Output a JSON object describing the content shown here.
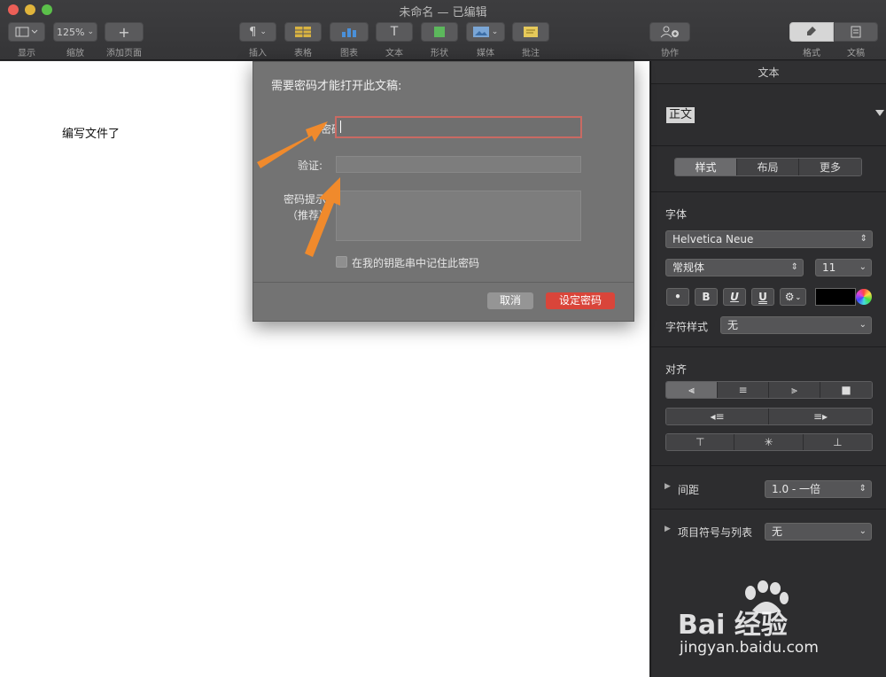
{
  "window": {
    "title": "未命名 — 已编辑"
  },
  "toolbar": {
    "display_label": "显示",
    "zoom_value": "125%",
    "zoom_label": "缩放",
    "add_page_label": "添加页面",
    "insert_label": "插入",
    "table_label": "表格",
    "chart_label": "图表",
    "text_label": "文本",
    "shape_label": "形状",
    "media_label": "媒体",
    "comment_label": "批注",
    "collaborate_label": "协作",
    "format_label": "格式",
    "document_label": "文稿"
  },
  "document": {
    "body_text": "编写文件了"
  },
  "dialog": {
    "title": "需要密码才能打开此文稿:",
    "password_label": "密码",
    "password_value": "",
    "verify_label": "验证:",
    "verify_value": "",
    "hint_label_1": "密码提示",
    "hint_label_2": "（推荐）",
    "hint_value": "",
    "keychain_label": "在我的钥匙串中记住此密码",
    "keychain_checked": false,
    "cancel_label": "取消",
    "set_password_label": "设定密码"
  },
  "sidebar": {
    "header": "文本",
    "paragraph_style": "正文",
    "tabs": [
      {
        "label": "样式",
        "active": true
      },
      {
        "label": "布局",
        "active": false
      },
      {
        "label": "更多",
        "active": false
      }
    ],
    "font_section": "字体",
    "font_family": "Helvetica Neue",
    "font_style": "常规体",
    "font_size": "11",
    "bullet_btn": "•",
    "bold_btn": "B",
    "italic_btn": "I",
    "underline_btn": "U",
    "strike_btn": "U",
    "text_color": "#000000",
    "char_style_label": "字符样式",
    "char_style_value": "无",
    "align_section": "对齐",
    "spacing_label": "间距",
    "spacing_value": "1.0 - 一倍",
    "bullets_label": "项目符号与列表",
    "bullets_value": "无"
  },
  "watermark": {
    "brand": "Bai 经验",
    "url": "jingyan.baidu.com"
  },
  "colors": {
    "accent_red": "#d9453a",
    "focus_ring": "#c96a63",
    "arrow": "#f08a2c"
  }
}
